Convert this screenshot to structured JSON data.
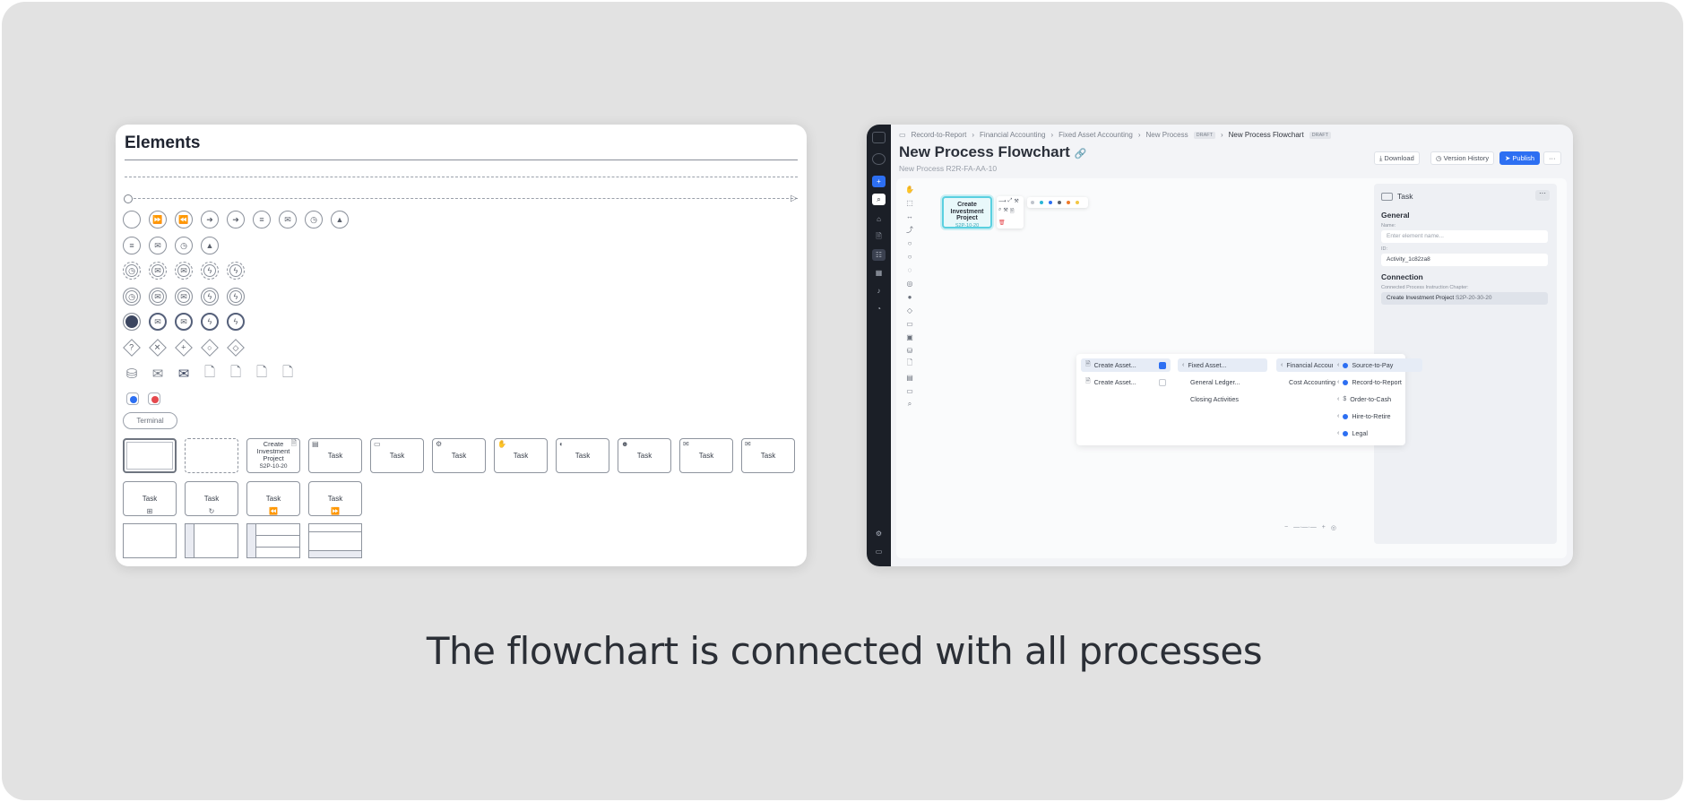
{
  "caption": "The flowchart is connected with all processes",
  "elements_panel": {
    "title": "Elements",
    "terminal_label": "Terminal",
    "task_label": "Task",
    "create_investment_project": {
      "line1": "Create",
      "line2": "Investment",
      "line3": "Project",
      "code": "S2P-10-20"
    }
  },
  "app": {
    "breadcrumb": [
      {
        "label": "Record-to-Report"
      },
      {
        "label": "Financial Accounting"
      },
      {
        "label": "Fixed Asset Accounting"
      },
      {
        "label": "New Process",
        "tag": "DRAFT"
      },
      {
        "label": "New Process Flowchart",
        "tag": "DRAFT"
      }
    ],
    "title": "New Process Flowchart",
    "subtitle_prefix": "New Process",
    "subtitle_code": "R2R-FA-AA-10",
    "buttons": {
      "download": "Download",
      "version_history": "Version History",
      "publish": "Publish",
      "more": "···"
    },
    "canvas_node": {
      "line1": "Create",
      "line2": "Investment",
      "line3": "Project",
      "code": "S2P-10-20"
    },
    "palette_colors": [
      "#bfc4cc",
      "#2bb6d6",
      "#2d6ff2",
      "#5a606b",
      "#f07a2a",
      "#f2c744"
    ],
    "properties": {
      "header": "Task",
      "general": "General",
      "name_label": "Name:",
      "name_placeholder": "Enter element name...",
      "id_label": "ID:",
      "id_value": "Activity_1c82za8",
      "connection": "Connection",
      "connected_label": "Connected Process Instruction Chapter:",
      "connected_value": "Create Investment Project",
      "connected_code": "S2P-20-30-20"
    },
    "cascade": {
      "col1": [
        "Create Asset...",
        "Create Asset..."
      ],
      "col2": [
        "Fixed Asset...",
        "General Ledger...",
        "Closing Activities"
      ],
      "col3": [
        "Financial Accounting",
        "Cost Accounting"
      ],
      "col4": [
        {
          "label": "Source-to-Pay",
          "color": "#2d6ff2"
        },
        {
          "label": "Record-to-Report",
          "color": "#2d6ff2"
        },
        {
          "label": "Order-to-Cash",
          "color": "#8a909b"
        },
        {
          "label": "Hire-to-Retire",
          "color": "#2d6ff2"
        },
        {
          "label": "Legal",
          "color": "#2d6ff2"
        }
      ]
    }
  }
}
